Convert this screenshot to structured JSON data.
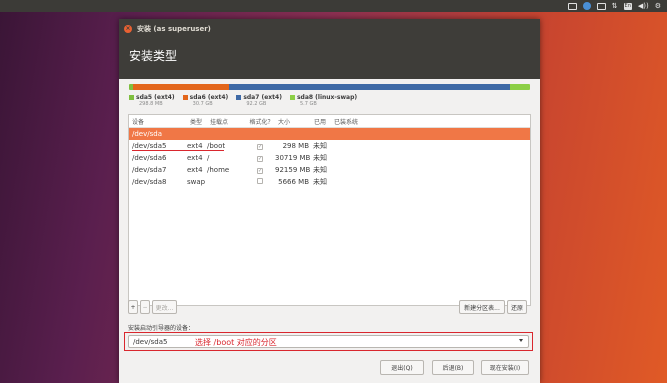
{
  "window": {
    "title": "安装 (as superuser)",
    "heading": "安装类型"
  },
  "topbar": {
    "tray": [
      "En",
      "⇅",
      "◀))",
      "⚙"
    ]
  },
  "legend": [
    {
      "name": "sda5 (ext4)",
      "size": "298.8 MB",
      "color": "#7fbf3f"
    },
    {
      "name": "sda6 (ext4)",
      "size": "30.7 GB",
      "color": "#e3661b"
    },
    {
      "name": "sda7 (ext4)",
      "size": "92.2 GB",
      "color": "#3f6aa6"
    },
    {
      "name": "sda8 (linux-swap)",
      "size": "5.7 GB",
      "color": "#8ccf45"
    }
  ],
  "table": {
    "headers": [
      "设备",
      "类型",
      "挂载点",
      "格式化？",
      "大小",
      "已用",
      "已装系统"
    ],
    "rows": [
      {
        "device": "/dev/sda",
        "type": "",
        "mount": "",
        "size": "",
        "used": ""
      },
      {
        "device": "/dev/sda5",
        "type": "ext4",
        "mount": "/boot",
        "size": "298 MB",
        "used": "未知"
      },
      {
        "device": "/dev/sda6",
        "type": "ext4",
        "mount": "/",
        "size": "30719 MB",
        "used": "未知"
      },
      {
        "device": "/dev/sda7",
        "type": "ext4",
        "mount": "/home",
        "size": "92159 MB",
        "used": "未知"
      },
      {
        "device": "/dev/sda8",
        "type": "swap",
        "mount": "",
        "size": "5666 MB",
        "used": "未知"
      }
    ]
  },
  "controls": {
    "add": "+",
    "remove": "−",
    "change": "更改...",
    "new_table": "新建分区表...",
    "revert": "还原"
  },
  "boot": {
    "label": "安装启动引导器的设备：",
    "value": "/dev/sda5",
    "note": "选择 /boot 对应的分区"
  },
  "footer": {
    "quit": "退出(Q)",
    "back": "后退(B)",
    "install": "现在安装(I)"
  },
  "colors": {
    "accent": "#f07746",
    "annotation": "#d9272e"
  }
}
